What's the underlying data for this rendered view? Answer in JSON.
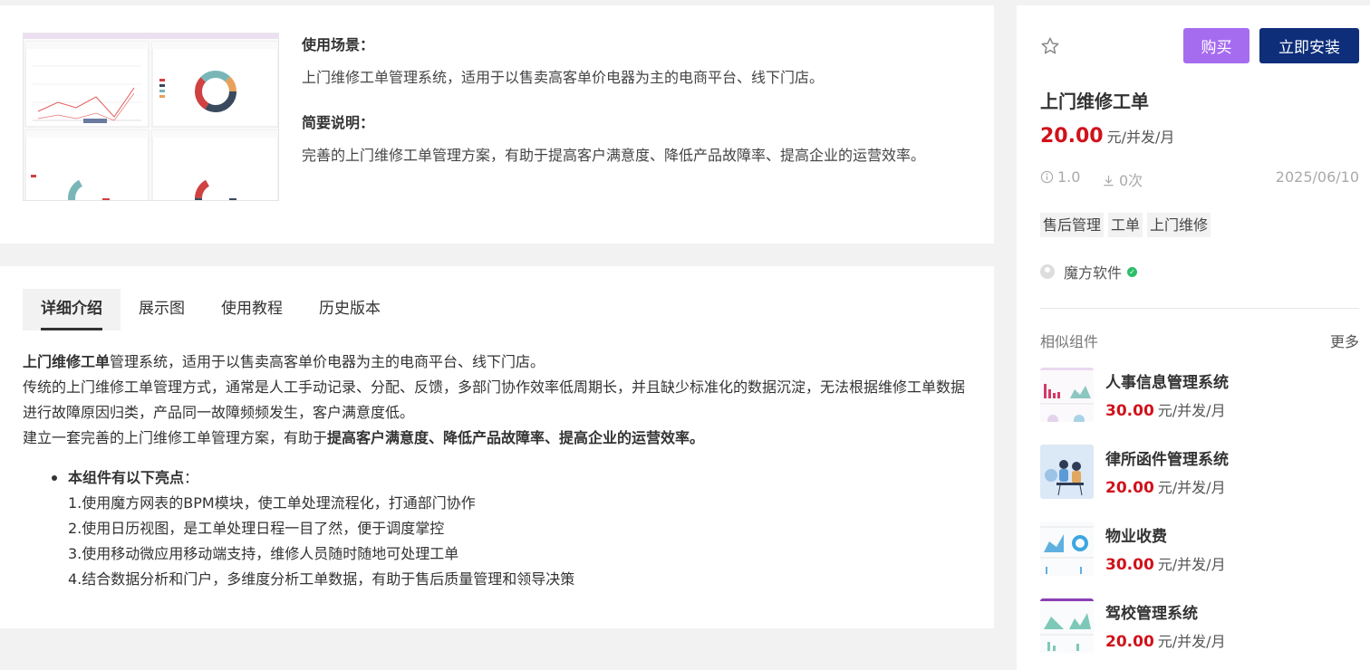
{
  "overview": {
    "scene_title": "使用场景：",
    "scene_text": "上门维修工单管理系统，适用于以售卖高客单价电器为主的电商平台、线下门店。",
    "brief_title": "简要说明：",
    "brief_text": "完善的上门维修工单管理方案，有助于提高客户满意度、降低产品故障率、提高企业的运营效率。"
  },
  "tabs": [
    {
      "label": "详细介绍",
      "active": true
    },
    {
      "label": "展示图",
      "active": false
    },
    {
      "label": "使用教程",
      "active": false
    },
    {
      "label": "历史版本",
      "active": false
    }
  ],
  "detail": {
    "line1_bold": "上门维修工单",
    "line1_rest": "管理系统，适用于以售卖高客单价电器为主的电商平台、线下门店。",
    "line2": "传统的上门维修工单管理方式，通常是人工手动记录、分配、反馈，多部门协作效率低周期长，并且缺少标准化的数据沉淀，无法根据维修工单数据进行故障原因归类，产品同一故障频频发生，客户满意度低。",
    "line3_rest": "建立一套完善的上门维修工单管理方案，有助于",
    "line3_bold": "提高客户满意度、降低产品故障率、提高企业的运营效率",
    "line3_end": "。",
    "highlights_title": "本组件有以下亮点",
    "highlights_colon": "：",
    "highlights": [
      "1.使用魔方网表的BPM模块，使工单处理流程化，打通部门协作",
      "2.使用日历视图，是工单处理日程一目了然，便于调度掌控",
      "3.使用移动微应用移动端支持，维修人员随时随地可处理工单",
      "4.结合数据分析和门户，多维度分析工单数据，有助于售后质量管理和领导决策"
    ]
  },
  "sidebar": {
    "star_icon": "star-outline-icon",
    "buy_label": "购买",
    "install_label": "立即安装",
    "title": "上门维修工单",
    "price_amount": "20.00",
    "price_unit": "元/并发/月",
    "version": "1.0",
    "downloads": "0次",
    "date": "2025/06/10",
    "tags": [
      "售后管理",
      "工单",
      "上门维修"
    ],
    "author": "魔方软件",
    "similar_title": "相似组件",
    "more_label": "更多",
    "similar": [
      {
        "name": "人事信息管理系统",
        "amount": "30.00",
        "unit": "元/并发/月"
      },
      {
        "name": "律所函件管理系统",
        "amount": "20.00",
        "unit": "元/并发/月"
      },
      {
        "name": "物业收费",
        "amount": "30.00",
        "unit": "元/并发/月"
      },
      {
        "name": "驾校管理系统",
        "amount": "20.00",
        "unit": "元/并发/月"
      }
    ]
  },
  "colors": {
    "buy": "#a66cf0",
    "install": "#0e2e7a",
    "price": "#d0121b",
    "verified": "#2bbf6a"
  }
}
